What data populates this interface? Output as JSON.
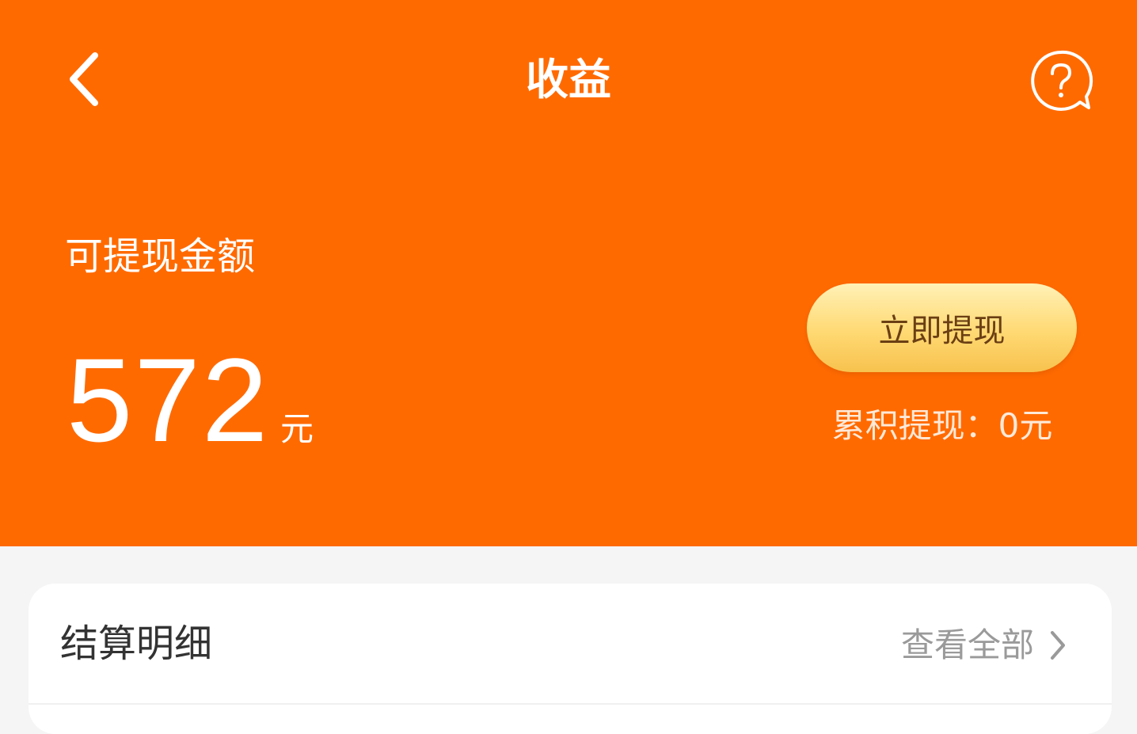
{
  "header": {
    "title": "收益",
    "back_icon": "chevron-left-icon",
    "help_icon": "question-bubble-icon",
    "background_color": "#ff6a00"
  },
  "balance": {
    "label": "可提现金额",
    "amount": "572",
    "unit": "元"
  },
  "withdraw": {
    "button_label": "立即提现",
    "total_label": "累积提现：0元"
  },
  "settlement": {
    "title": "结算明细",
    "view_all_label": "查看全部",
    "view_all_icon": "chevron-right-icon"
  }
}
